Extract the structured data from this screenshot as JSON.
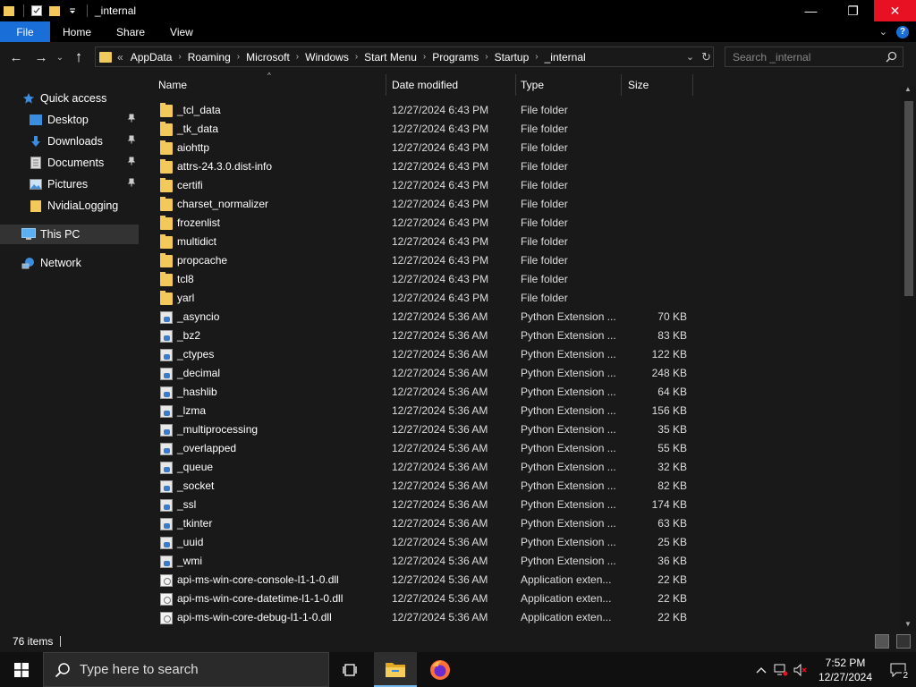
{
  "window": {
    "title": "_internal",
    "minimize_glyph": "—",
    "maximize_glyph": "❐",
    "close_glyph": "✕"
  },
  "ribbon": {
    "file": "File",
    "home": "Home",
    "share": "Share",
    "view": "View",
    "expand_glyph": "⌄",
    "help_glyph": "?"
  },
  "nav": {
    "back_glyph": "←",
    "forward_glyph": "→",
    "recent_glyph": "⌄",
    "up_glyph": "↑",
    "overflow_glyph": "«",
    "breadcrumb": [
      "AppData",
      "Roaming",
      "Microsoft",
      "Windows",
      "Start Menu",
      "Programs",
      "Startup",
      "_internal"
    ],
    "separator_glyph": "›",
    "dropdown_glyph": "⌄",
    "refresh_glyph": "↻"
  },
  "search": {
    "placeholder": "Search _internal"
  },
  "sidebar": {
    "quick_access": "Quick access",
    "desktop": "Desktop",
    "downloads": "Downloads",
    "documents": "Documents",
    "pictures": "Pictures",
    "nvidia": "NvidiaLogging",
    "this_pc": "This PC",
    "network": "Network",
    "pin_glyph": "📌"
  },
  "columns": {
    "name": "Name",
    "date": "Date modified",
    "type": "Type",
    "size": "Size",
    "sort_glyph": "^"
  },
  "files": [
    {
      "kind": "folder",
      "name": "_tcl_data",
      "date": "12/27/2024 6:43 PM",
      "type": "File folder",
      "size": ""
    },
    {
      "kind": "folder",
      "name": "_tk_data",
      "date": "12/27/2024 6:43 PM",
      "type": "File folder",
      "size": ""
    },
    {
      "kind": "folder",
      "name": "aiohttp",
      "date": "12/27/2024 6:43 PM",
      "type": "File folder",
      "size": ""
    },
    {
      "kind": "folder",
      "name": "attrs-24.3.0.dist-info",
      "date": "12/27/2024 6:43 PM",
      "type": "File folder",
      "size": ""
    },
    {
      "kind": "folder",
      "name": "certifi",
      "date": "12/27/2024 6:43 PM",
      "type": "File folder",
      "size": ""
    },
    {
      "kind": "folder",
      "name": "charset_normalizer",
      "date": "12/27/2024 6:43 PM",
      "type": "File folder",
      "size": ""
    },
    {
      "kind": "folder",
      "name": "frozenlist",
      "date": "12/27/2024 6:43 PM",
      "type": "File folder",
      "size": ""
    },
    {
      "kind": "folder",
      "name": "multidict",
      "date": "12/27/2024 6:43 PM",
      "type": "File folder",
      "size": ""
    },
    {
      "kind": "folder",
      "name": "propcache",
      "date": "12/27/2024 6:43 PM",
      "type": "File folder",
      "size": ""
    },
    {
      "kind": "folder",
      "name": "tcl8",
      "date": "12/27/2024 6:43 PM",
      "type": "File folder",
      "size": ""
    },
    {
      "kind": "folder",
      "name": "yarl",
      "date": "12/27/2024 6:43 PM",
      "type": "File folder",
      "size": ""
    },
    {
      "kind": "pyd",
      "name": "_asyncio",
      "date": "12/27/2024 5:36 AM",
      "type": "Python Extension ...",
      "size": "70 KB"
    },
    {
      "kind": "pyd",
      "name": "_bz2",
      "date": "12/27/2024 5:36 AM",
      "type": "Python Extension ...",
      "size": "83 KB"
    },
    {
      "kind": "pyd",
      "name": "_ctypes",
      "date": "12/27/2024 5:36 AM",
      "type": "Python Extension ...",
      "size": "122 KB"
    },
    {
      "kind": "pyd",
      "name": "_decimal",
      "date": "12/27/2024 5:36 AM",
      "type": "Python Extension ...",
      "size": "248 KB"
    },
    {
      "kind": "pyd",
      "name": "_hashlib",
      "date": "12/27/2024 5:36 AM",
      "type": "Python Extension ...",
      "size": "64 KB"
    },
    {
      "kind": "pyd",
      "name": "_lzma",
      "date": "12/27/2024 5:36 AM",
      "type": "Python Extension ...",
      "size": "156 KB"
    },
    {
      "kind": "pyd",
      "name": "_multiprocessing",
      "date": "12/27/2024 5:36 AM",
      "type": "Python Extension ...",
      "size": "35 KB"
    },
    {
      "kind": "pyd",
      "name": "_overlapped",
      "date": "12/27/2024 5:36 AM",
      "type": "Python Extension ...",
      "size": "55 KB"
    },
    {
      "kind": "pyd",
      "name": "_queue",
      "date": "12/27/2024 5:36 AM",
      "type": "Python Extension ...",
      "size": "32 KB"
    },
    {
      "kind": "pyd",
      "name": "_socket",
      "date": "12/27/2024 5:36 AM",
      "type": "Python Extension ...",
      "size": "82 KB"
    },
    {
      "kind": "pyd",
      "name": "_ssl",
      "date": "12/27/2024 5:36 AM",
      "type": "Python Extension ...",
      "size": "174 KB"
    },
    {
      "kind": "pyd",
      "name": "_tkinter",
      "date": "12/27/2024 5:36 AM",
      "type": "Python Extension ...",
      "size": "63 KB"
    },
    {
      "kind": "pyd",
      "name": "_uuid",
      "date": "12/27/2024 5:36 AM",
      "type": "Python Extension ...",
      "size": "25 KB"
    },
    {
      "kind": "pyd",
      "name": "_wmi",
      "date": "12/27/2024 5:36 AM",
      "type": "Python Extension ...",
      "size": "36 KB"
    },
    {
      "kind": "dll",
      "name": "api-ms-win-core-console-l1-1-0.dll",
      "date": "12/27/2024 5:36 AM",
      "type": "Application exten...",
      "size": "22 KB"
    },
    {
      "kind": "dll",
      "name": "api-ms-win-core-datetime-l1-1-0.dll",
      "date": "12/27/2024 5:36 AM",
      "type": "Application exten...",
      "size": "22 KB"
    },
    {
      "kind": "dll",
      "name": "api-ms-win-core-debug-l1-1-0.dll",
      "date": "12/27/2024 5:36 AM",
      "type": "Application exten...",
      "size": "22 KB"
    }
  ],
  "status": {
    "count": "76 items"
  },
  "taskbar": {
    "search_placeholder": "Type here to search",
    "time": "7:52 PM",
    "date": "12/27/2024",
    "notification_count": "2"
  },
  "colors": {
    "accent": "#1a6ed8",
    "folder": "#f2c95a",
    "close": "#e81123",
    "background": "#191919"
  }
}
